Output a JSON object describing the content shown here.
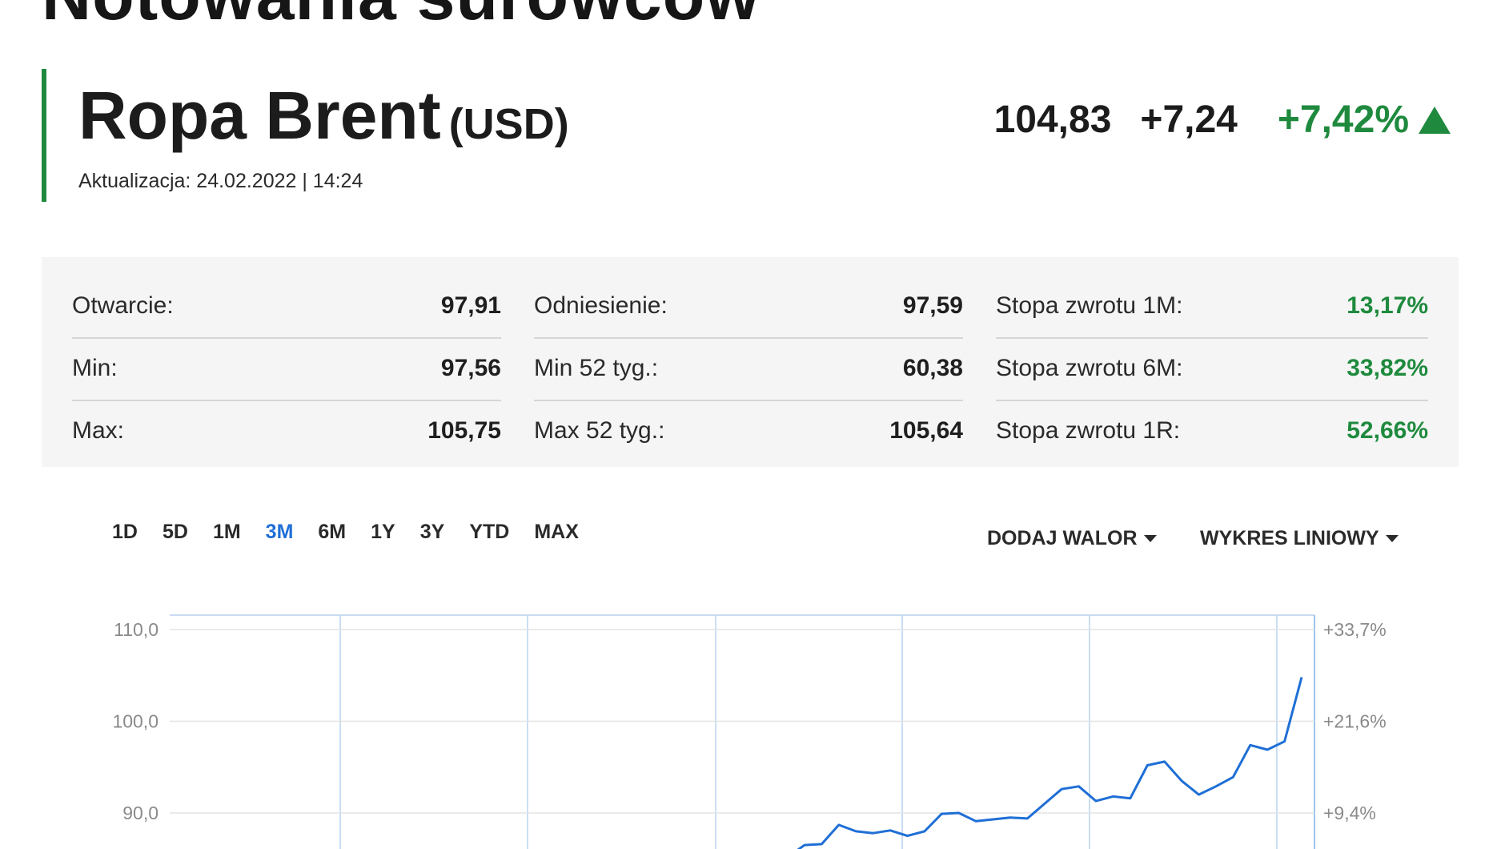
{
  "page": {
    "title": "Notowania surowców"
  },
  "instrument": {
    "name": "Ropa Brent",
    "currency": "(USD)",
    "updated": "Aktualizacja: 24.02.2022 | 14:24",
    "price": "104,83",
    "change": "+7,24",
    "change_pct": "+7,42%",
    "trend_icon": "triangle-up-icon",
    "colors": {
      "accent": "#1f8a3e",
      "positive": "#1f8a3e",
      "chart_line": "#1f6fd6"
    }
  },
  "stats": {
    "columns": [
      [
        {
          "label": "Otwarcie:",
          "value": "97,91"
        },
        {
          "label": "Min:",
          "value": "97,56"
        },
        {
          "label": "Max:",
          "value": "105,75"
        }
      ],
      [
        {
          "label": "Odniesienie:",
          "value": "97,59"
        },
        {
          "label": "Min 52 tyg.:",
          "value": "60,38"
        },
        {
          "label": "Max 52 tyg.:",
          "value": "105,64"
        }
      ],
      [
        {
          "label": "Stopa zwrotu 1M:",
          "value": "13,17%"
        },
        {
          "label": "Stopa zwrotu 6M:",
          "value": "33,82%"
        },
        {
          "label": "Stopa zwrotu 1R:",
          "value": "52,66%"
        }
      ]
    ]
  },
  "range_tabs": [
    "1D",
    "5D",
    "1M",
    "3M",
    "6M",
    "1Y",
    "3Y",
    "YTD",
    "MAX"
  ],
  "active_range": "3M",
  "controls": {
    "add_security": "DODAJ WALOR",
    "chart_type": "WYKRES LINIOWY"
  },
  "chart_data": {
    "type": "line",
    "y_ticks": [
      "110,0",
      "100,0",
      "90,0"
    ],
    "y_tick_values": [
      110,
      100,
      90
    ],
    "y2_ticks": [
      "+33,7%",
      "+21,6%",
      "+9,4%"
    ],
    "ylim": [
      86,
      112
    ],
    "grid": true,
    "series": [
      {
        "values": [
          86.5,
          86.6,
          88.7,
          88.0,
          87.8,
          88.1,
          87.5,
          88.0,
          89.9,
          90.0,
          89.1,
          89.3,
          89.5,
          89.4,
          91.0,
          92.6,
          92.9,
          91.3,
          91.8,
          91.6,
          95.2,
          95.6,
          93.5,
          92.0,
          92.9,
          93.9,
          97.4,
          96.9,
          97.8,
          104.8
        ]
      }
    ]
  }
}
